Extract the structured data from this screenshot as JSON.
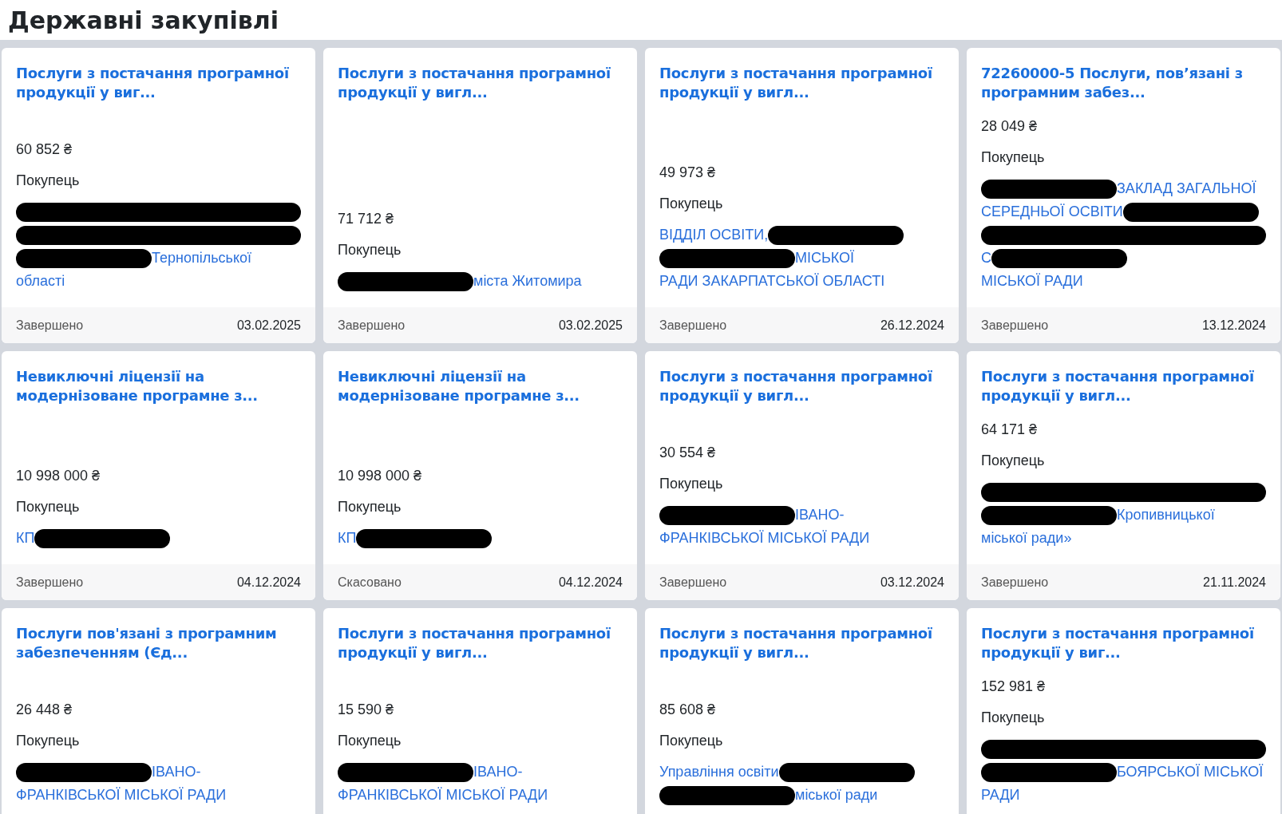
{
  "page_title": "Державні закупівлі",
  "cards": [
    {
      "title": "Послуги з постачання програмної продукції у виг...",
      "price": "60 852 ₴",
      "buyer_label": "Покупець",
      "buyer_lines": [
        [
          {
            "kind": "redacted"
          }
        ],
        [
          {
            "kind": "redacted"
          }
        ],
        [
          {
            "kind": "redacted"
          },
          {
            "kind": "text",
            "text": "Тернопільської"
          }
        ],
        [
          {
            "kind": "text",
            "text": "області"
          }
        ]
      ],
      "status": "Завершено",
      "date": "03.02.2025"
    },
    {
      "title": "Послуги з постачання програмної продукції у вигл...",
      "price": "71 712 ₴",
      "buyer_label": "Покупець",
      "buyer_lines": [
        [
          {
            "kind": "redacted"
          },
          {
            "kind": "text",
            "text": "міста Житомира"
          }
        ]
      ],
      "status": "Завершено",
      "date": "03.02.2025"
    },
    {
      "title": "Послуги з постачання програмної продукції у вигл...",
      "price": "49 973 ₴",
      "buyer_label": "Покупець",
      "buyer_lines": [
        [
          {
            "kind": "text",
            "text": "ВІДДІЛ ОСВІТИ,"
          },
          {
            "kind": "redacted"
          }
        ],
        [
          {
            "kind": "redacted"
          },
          {
            "kind": "text",
            "text": "МІСЬКОЇ"
          }
        ],
        [
          {
            "kind": "text",
            "text": "РАДИ ЗАКАРПАТСЬКОЇ ОБЛАСТІ"
          }
        ]
      ],
      "status": "Завершено",
      "date": "26.12.2024"
    },
    {
      "title": "72260000-5 Послуги, пов’язані з програмним забез...",
      "price": "28 049 ₴",
      "buyer_label": "Покупець",
      "buyer_lines": [
        [
          {
            "kind": "redacted"
          },
          {
            "kind": "text",
            "text": "ЗАКЛАД ЗАГАЛЬНОЇ"
          }
        ],
        [
          {
            "kind": "text",
            "text": "СЕРЕДНЬОЇ ОСВІТИ"
          },
          {
            "kind": "redacted"
          }
        ],
        [
          {
            "kind": "redacted"
          }
        ],
        [
          {
            "kind": "text",
            "text": "С"
          },
          {
            "kind": "redacted"
          }
        ],
        [
          {
            "kind": "text",
            "text": "МІСЬКОЇ РАДИ"
          }
        ]
      ],
      "status": "Завершено",
      "date": "13.12.2024"
    },
    {
      "title": "Невиключні ліцензії на модернізоване програмне з...",
      "price": "10 998 000 ₴",
      "buyer_label": "Покупець",
      "buyer_lines": [
        [
          {
            "kind": "text",
            "text": "КП"
          },
          {
            "kind": "redacted"
          }
        ]
      ],
      "status": "Завершено",
      "date": "04.12.2024"
    },
    {
      "title": "Невиключні ліцензії на модернізоване програмне з...",
      "price": "10 998 000 ₴",
      "buyer_label": "Покупець",
      "buyer_lines": [
        [
          {
            "kind": "text",
            "text": "КП"
          },
          {
            "kind": "redacted"
          }
        ]
      ],
      "status": "Скасовано",
      "date": "04.12.2024"
    },
    {
      "title": "Послуги з постачання програмної продукції у вигл...",
      "price": "30 554 ₴",
      "buyer_label": "Покупець",
      "buyer_lines": [
        [
          {
            "kind": "redacted"
          },
          {
            "kind": "text",
            "text": "ІВАНО-"
          }
        ],
        [
          {
            "kind": "text",
            "text": "ФРАНКІВСЬКОЇ МІСЬКОЇ РАДИ"
          }
        ]
      ],
      "status": "Завершено",
      "date": "03.12.2024"
    },
    {
      "title": "Послуги з постачання програмної продукції у вигл...",
      "price": "64 171 ₴",
      "buyer_label": "Покупець",
      "buyer_lines": [
        [
          {
            "kind": "redacted"
          }
        ],
        [
          {
            "kind": "redacted"
          },
          {
            "kind": "text",
            "text": "Кропивницької"
          }
        ],
        [
          {
            "kind": "text",
            "text": "міської ради»"
          }
        ]
      ],
      "status": "Завершено",
      "date": "21.11.2024"
    },
    {
      "title": "Послуги пов'язані з програмним забезпеченням (Єд...",
      "price": "26 448 ₴",
      "buyer_label": "Покупець",
      "buyer_lines": [
        [
          {
            "kind": "redacted"
          },
          {
            "kind": "text",
            "text": "ІВАНО-"
          }
        ],
        [
          {
            "kind": "text",
            "text": "ФРАНКІВСЬКОЇ МІСЬКОЇ РАДИ"
          }
        ]
      ]
    },
    {
      "title": "Послуги з постачання програмної продукції у вигл...",
      "price": "15 590 ₴",
      "buyer_label": "Покупець",
      "buyer_lines": [
        [
          {
            "kind": "redacted"
          },
          {
            "kind": "text",
            "text": "ІВАНО-"
          }
        ],
        [
          {
            "kind": "text",
            "text": "ФРАНКІВСЬКОЇ МІСЬКОЇ РАДИ"
          }
        ]
      ]
    },
    {
      "title": "Послуги з постачання програмної продукції у вигл...",
      "price": "85 608 ₴",
      "buyer_label": "Покупець",
      "buyer_lines": [
        [
          {
            "kind": "text",
            "text": "Управління освіти"
          },
          {
            "kind": "redacted"
          }
        ],
        [
          {
            "kind": "redacted"
          },
          {
            "kind": "text",
            "text": "міської ради"
          }
        ]
      ]
    },
    {
      "title": "Послуги з постачання програмної продукції у виг...",
      "price": "152 981 ₴",
      "buyer_label": "Покупець",
      "buyer_lines": [
        [
          {
            "kind": "redacted"
          }
        ],
        [
          {
            "kind": "redacted"
          },
          {
            "kind": "text",
            "text": "БОЯРСЬКОЇ МІСЬКОЇ"
          }
        ],
        [
          {
            "kind": "text",
            "text": "РАДИ"
          }
        ]
      ]
    }
  ]
}
